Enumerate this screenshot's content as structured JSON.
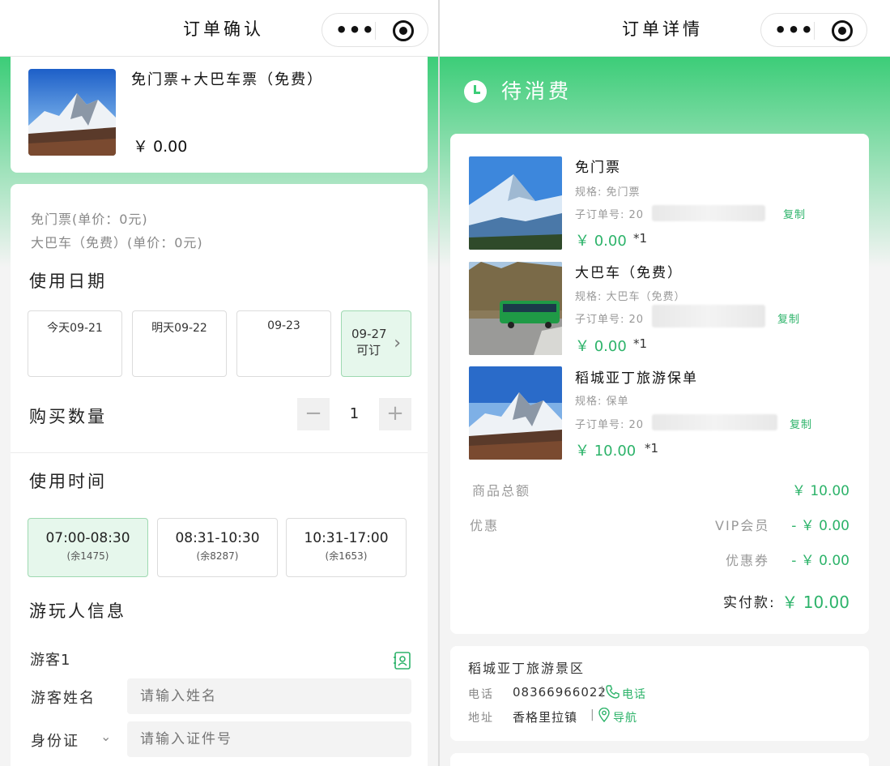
{
  "left": {
    "nav": {
      "title": "订单确认",
      "more": "•••"
    },
    "product": {
      "name": "免门票+大巴车票（免费）",
      "price": "￥ 0.00"
    },
    "summary": {
      "line1": "免门票(单价：0元)",
      "line2": "大巴车（免费）(单价：0元)"
    },
    "date": {
      "heading": "使用日期",
      "options": [
        "今天09-21",
        "明天09-22",
        "09-23"
      ],
      "more_date": "09-27",
      "more_label": "可订"
    },
    "quantity": {
      "heading": "购买数量",
      "minus": "−",
      "value": "1",
      "plus": "+"
    },
    "time": {
      "heading": "使用时间",
      "slots": [
        {
          "range": "07:00-08:30",
          "remain": "(余1475)"
        },
        {
          "range": "08:31-10:30",
          "remain": "(余8287)"
        },
        {
          "range": "10:31-17:00",
          "remain": "(余1653)"
        }
      ]
    },
    "player": {
      "heading": "游玩人信息",
      "guest": "游客1",
      "name_label": "游客姓名",
      "name_placeholder": "请输入姓名",
      "id_label": "身份证",
      "id_placeholder": "请输入证件号"
    }
  },
  "right": {
    "nav": {
      "title": "订单详情",
      "more": "•••"
    },
    "status": "待消费",
    "items": [
      {
        "name": "免门票",
        "spec": "规格: 免门票",
        "sub": "子订单号: 20",
        "copy": "复制",
        "price": "￥ 0.00",
        "qty": "*1"
      },
      {
        "name": "大巴车（免费）",
        "spec": "规格: 大巴车（免费）",
        "sub": "子订单号: 20",
        "copy": "复制",
        "price": "￥ 0.00",
        "qty": "*1"
      },
      {
        "name": "稻城亚丁旅游保单",
        "spec": "规格: 保单",
        "sub": "子订单号: 20",
        "copy": "复制",
        "price": "￥ 10.00",
        "qty": "*1"
      }
    ],
    "totals": {
      "goods_label": "商品总额",
      "goods_value": "￥ 10.00",
      "discount_label": "优惠",
      "vip_label": "VIP会员",
      "vip_value": "- ￥ 0.00",
      "coupon_label": "优惠券",
      "coupon_value": "- ￥ 0.00",
      "paid_label": "实付款:",
      "paid_value": "￥ 10.00"
    },
    "scenic": {
      "name": "稻城亚丁旅游景区",
      "phone_label": "电话",
      "phone_value": "08366966022",
      "phone_link": "电话",
      "addr_label": "地址",
      "addr_value": "香格里拉镇",
      "addr_link": "导航"
    }
  },
  "colors": {
    "accent": "#3ccd78",
    "price": "#2db36a"
  }
}
